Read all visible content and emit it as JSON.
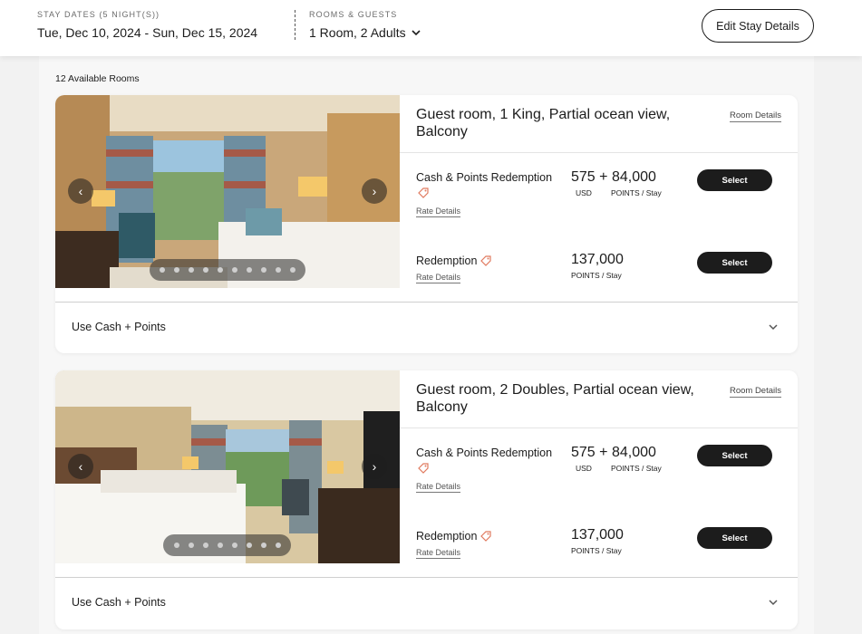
{
  "header": {
    "stay_label": "STAY DATES (5 NIGHT(S))",
    "stay_value": "Tue, Dec 10, 2024 - Sun, Dec 15, 2024",
    "guests_label": "ROOMS & GUESTS",
    "guests_value": "1 Room, 2 Adults",
    "edit_button": "Edit Stay Details"
  },
  "available_text": "12 Available Rooms",
  "rooms": [
    {
      "title": "Guest room, 1 King, Partial ocean view, Balcony",
      "room_details": "Room Details",
      "photo_dots": 10,
      "rates": [
        {
          "name": "Cash & Points Redemption",
          "details": "Rate Details",
          "cash": "575",
          "plus": "+",
          "points": "84,000",
          "cash_unit": "USD",
          "points_unit": "POINTS / Stay",
          "select": "Select"
        },
        {
          "name": "Redemption",
          "details": "Rate Details",
          "points": "137,000",
          "points_unit": "POINTS / Stay",
          "select": "Select"
        }
      ],
      "footer": "Use Cash + Points"
    },
    {
      "title": "Guest room, 2 Doubles, Partial ocean view, Balcony",
      "room_details": "Room Details",
      "photo_dots": 8,
      "rates": [
        {
          "name": "Cash & Points Redemption",
          "details": "Rate Details",
          "cash": "575",
          "plus": "+",
          "points": "84,000",
          "cash_unit": "USD",
          "points_unit": "POINTS / Stay",
          "select": "Select"
        },
        {
          "name": "Redemption",
          "details": "Rate Details",
          "points": "137,000",
          "points_unit": "POINTS / Stay",
          "select": "Select"
        }
      ],
      "footer": "Use Cash + Points"
    }
  ],
  "icons": {
    "prev": "chevron-left-icon",
    "next": "chevron-right-icon",
    "tag": "tag-icon",
    "expand": "chevron-down-icon"
  },
  "colors": {
    "button_bg": "#1c1c1c",
    "tag_accent": "#e07a5f"
  }
}
